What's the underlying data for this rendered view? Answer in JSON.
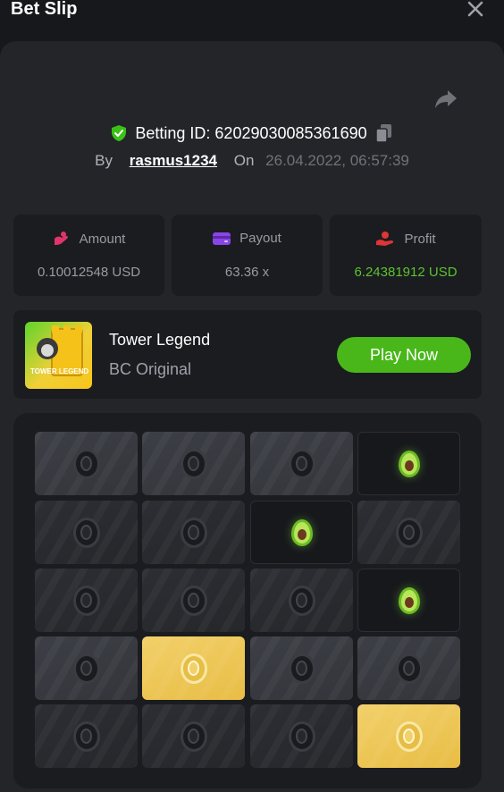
{
  "header": {
    "title": "Bet Slip"
  },
  "bet": {
    "id_text": "Betting ID: 62029030085361690",
    "by_label": "By",
    "user": "rasmus1234",
    "on_label": "On",
    "date": "26.04.2022, 06:57:39"
  },
  "stats": [
    {
      "label": "Amount",
      "value": "0.10012548 USD"
    },
    {
      "label": "Payout",
      "value": "63.36 x"
    },
    {
      "label": "Profit",
      "value": "6.24381912 USD"
    }
  ],
  "game": {
    "name": "Tower Legend",
    "subtitle": "BC Original",
    "play_label": "Play Now",
    "thumb_text": "TOWER LEGEND"
  },
  "board": {
    "rows": [
      [
        "stone",
        "stone",
        "stone",
        "avocado"
      ],
      [
        "dark",
        "dark",
        "avocado",
        "dark"
      ],
      [
        "dark",
        "dark",
        "dark",
        "avocado"
      ],
      [
        "stone",
        "gold",
        "stone",
        "stone"
      ],
      [
        "dark",
        "dark",
        "dark",
        "gold"
      ]
    ]
  },
  "colors": {
    "accent_green": "#49b71a",
    "profit_green": "#5ec22d",
    "shield_green": "#3bc117"
  }
}
